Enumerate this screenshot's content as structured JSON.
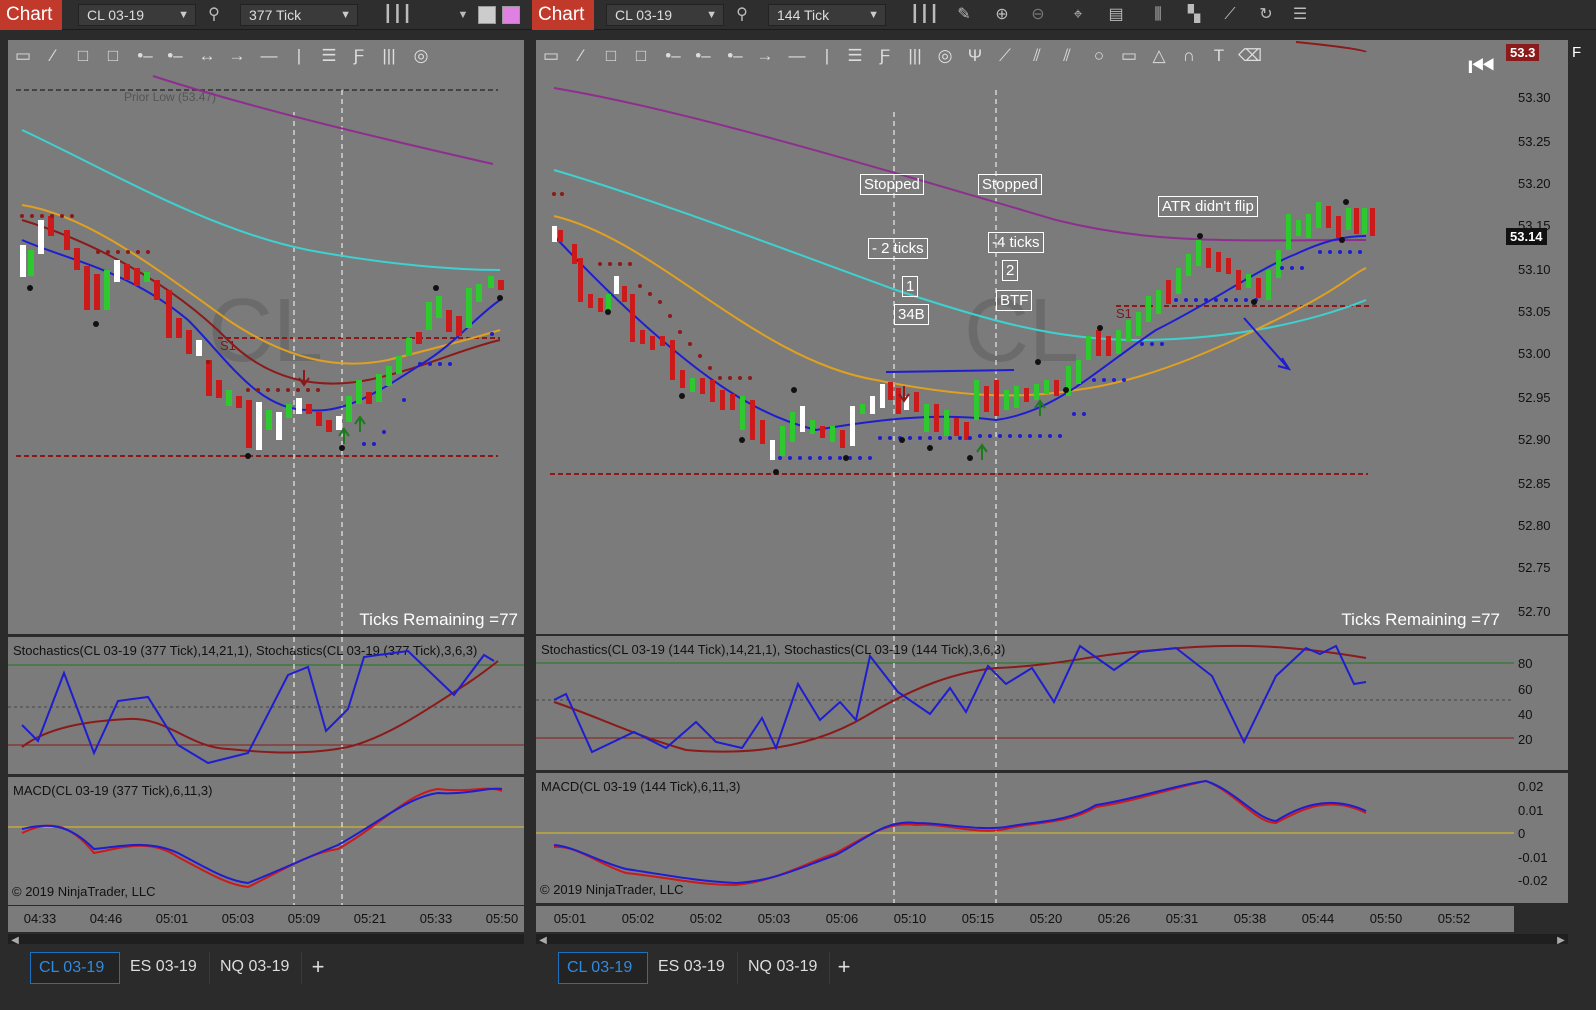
{
  "colors": {
    "accent_red": "#c0392b",
    "tab_active": "#2f8ae0",
    "panel_bg": "#7b7b7b",
    "stoch_k": "#1e1ed0",
    "stoch_d": "#8b1a1a",
    "macd_line": "#1e1ed0",
    "macd_signal": "#cc1a1a",
    "ma_purple": "#8e2e8e",
    "ma_cyan": "#3fd0d0",
    "ma_orange": "#e0a020",
    "ma_blue": "#1e1ed0",
    "level_dashed_red": "#8b1a1a"
  },
  "left_window": {
    "chart_button": "Chart",
    "instrument": "CL 03-19",
    "interval": "377 Tick",
    "toolbar_icons": [
      "search-icon",
      "bars-style-icon",
      "dropdown-icon",
      "color-swatch-icon",
      "color-swatch-pink-icon"
    ],
    "drawing_tools": [
      "ruler-icon",
      "risk-reward-icon",
      "region-icon",
      "region-highlight-icon",
      "line-icon",
      "ray-icon",
      "extended-line-icon",
      "arrow-line-icon",
      "horizontal-line-icon",
      "vertical-line-icon",
      "fib-retracement-icon",
      "fib-extension-icon",
      "fib-time-icon",
      "fib-circle-icon"
    ],
    "prior_low_label": "Prior Low (53.47)",
    "s1_label": "S1",
    "watermark": "CL",
    "ticks_remaining": "Ticks Remaining =77",
    "stoch_label": "Stochastics(CL 03-19 (377 Tick),14,21,1), Stochastics(CL 03-19 (377 Tick),3,6,3)",
    "macd_label": "MACD(CL 03-19 (377 Tick),6,11,3)",
    "copyright": "© 2019 NinjaTrader, LLC",
    "x_labels": [
      "04:33",
      "04:46",
      "05:01",
      "05:03",
      "05:09",
      "05:21",
      "05:33",
      "05:50"
    ],
    "tabs": [
      "CL 03-19",
      "ES 03-19",
      "NQ 03-19"
    ],
    "add_tab": "+"
  },
  "right_window": {
    "chart_button": "Chart",
    "instrument": "CL 03-19",
    "interval": "144 Tick",
    "toolbar_icons": [
      "search-icon",
      "bars-style-icon",
      "pencil-icon",
      "zoom-in-icon",
      "zoom-out-icon",
      "crosshair-icon",
      "data-box-icon",
      "properties-icon",
      "templates-icon",
      "strategies-icon",
      "refresh-icon",
      "list-icon"
    ],
    "drawing_tools": [
      "ruler-icon",
      "risk-reward-icon",
      "region-icon",
      "region-highlight-icon",
      "line-icon",
      "ray-icon",
      "extended-line-icon",
      "arrow-line-icon",
      "horizontal-line-icon",
      "vertical-line-icon",
      "fib-retracement-icon",
      "fib-extension-icon",
      "fib-time-icon",
      "fib-circle-icon",
      "andrews-pitchfork-icon",
      "gann-fan-icon",
      "regression-channel-icon",
      "trend-channel-icon",
      "ellipse-icon",
      "rectangle-icon",
      "triangle-icon",
      "arc-icon",
      "text-icon",
      "eraser-icon"
    ],
    "collapse_icon": "collapse-left-icon",
    "f_label": "F",
    "watermark": "CL",
    "s1_label": "S1",
    "annotations": {
      "stopped_1": "Stopped",
      "stopped_2": "Stopped",
      "minus2": "- 2 ticks",
      "minus4": "-4 ticks",
      "one": "1",
      "two": "2",
      "b34": "34B",
      "btf": "BTF",
      "atr": "ATR didn't flip"
    },
    "price_labels": [
      "53.30",
      "53.25",
      "53.20",
      "53.15",
      "53.10",
      "53.05",
      "53.00",
      "52.95",
      "52.90",
      "52.85",
      "52.80",
      "52.75",
      "52.70"
    ],
    "current_price": "53.14",
    "top_price_tag": "53.3",
    "stoch_axis": [
      "80",
      "60",
      "40",
      "20"
    ],
    "macd_axis": [
      "0.02",
      "0.01",
      "0",
      "-0.01",
      "-0.02"
    ],
    "ticks_remaining": "Ticks Remaining =77",
    "stoch_label": "Stochastics(CL 03-19 (144 Tick),14,21,1), Stochastics(CL 03-19 (144 Tick),3,6,3)",
    "macd_label": "MACD(CL 03-19 (144 Tick),6,11,3)",
    "copyright": "© 2019 NinjaTrader, LLC",
    "x_labels": [
      "05:01",
      "05:02",
      "05:02",
      "05:03",
      "05:06",
      "05:10",
      "05:15",
      "05:20",
      "05:26",
      "05:31",
      "05:38",
      "05:44",
      "05:50",
      "05:52"
    ],
    "tabs": [
      "CL 03-19",
      "ES 03-19",
      "NQ 03-19"
    ],
    "add_tab": "+"
  }
}
